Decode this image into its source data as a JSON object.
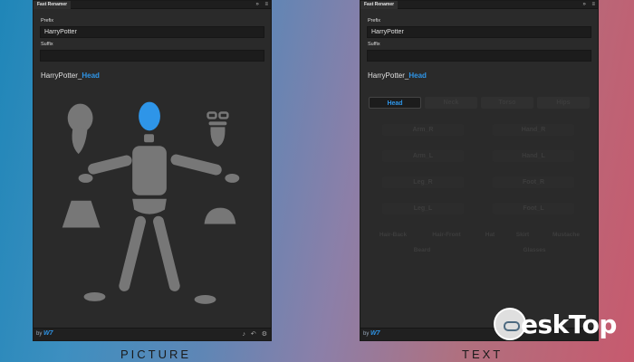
{
  "left_panel": {
    "tab_title": "Fast Renamer",
    "prefix_label": "Prefix",
    "prefix_value": "HarryPotter",
    "suffix_label": "Suffix",
    "suffix_value": "",
    "result_base": "HarryPotter_",
    "result_part": "Head",
    "brand_by": "by",
    "brand_name": "W7",
    "caption": "PICTURE"
  },
  "right_panel": {
    "tab_title": "Fast Renamer",
    "prefix_label": "Prefix",
    "prefix_value": "HarryPotter",
    "suffix_label": "Suffix",
    "suffix_value": "",
    "result_base": "HarryPotter_",
    "result_part": "Head",
    "brand_by": "by",
    "brand_name": "W7",
    "caption": "TEXT",
    "tabs": [
      "Head",
      "Neck",
      "Torso",
      "Hips"
    ],
    "limb_buttons": [
      [
        "Arm_R",
        "Hand_R"
      ],
      [
        "Arm_L",
        "Hand_L"
      ],
      [
        "Leg_R",
        "Foot_R"
      ],
      [
        "Leg_L",
        "Foot_L"
      ]
    ],
    "extra_row1": [
      "Hair-Back",
      "Hair-Front",
      "Hat",
      "Skirt",
      "Mustache"
    ],
    "extra_row2": [
      "Beard",
      "Glasses"
    ]
  },
  "topbar_icons": {
    "expand": "»",
    "menu": "≡"
  },
  "footer_icons": [
    "sound-icon",
    "undo-icon",
    "settings-icon"
  ],
  "watermark": "eskTop",
  "colors": {
    "accent": "#2e95e8",
    "panel": "#2a2a2a",
    "figure": "#777777"
  }
}
